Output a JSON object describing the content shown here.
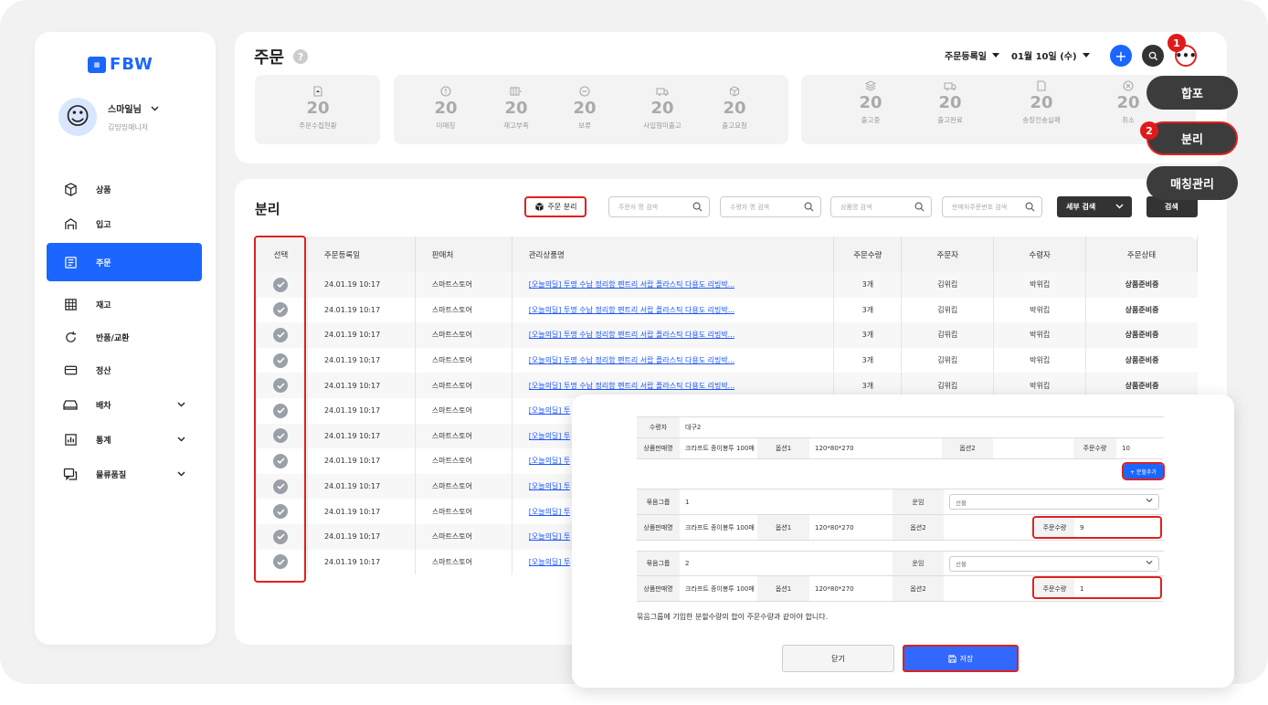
{
  "app": {
    "logo": "FBW"
  },
  "profile": {
    "name": "스마일님",
    "role": "김밍밍매니저"
  },
  "sidebar": {
    "items": [
      {
        "label": "상품",
        "icon": "box-icon"
      },
      {
        "label": "입고",
        "icon": "warehouse-icon"
      },
      {
        "label": "주문",
        "icon": "order-icon",
        "active": true
      },
      {
        "label": "재고",
        "icon": "grid-icon"
      },
      {
        "label": "반품/교환",
        "icon": "refresh-icon"
      },
      {
        "label": "정산",
        "icon": "card-icon"
      },
      {
        "label": "배차",
        "icon": "car-icon",
        "expandable": true
      },
      {
        "label": "통계",
        "icon": "chart-icon",
        "expandable": true
      },
      {
        "label": "물류품질",
        "icon": "chat-icon",
        "expandable": true
      }
    ]
  },
  "header": {
    "title": "주문",
    "date_type": "주문등록일",
    "date": "01월 10일 (수)",
    "stats_group1": [
      {
        "value": "20",
        "label": "주문수집현황"
      }
    ],
    "stats_group2": [
      {
        "value": "20",
        "label": "미매칭"
      },
      {
        "value": "20",
        "label": "재고부족"
      },
      {
        "value": "20",
        "label": "보류"
      },
      {
        "value": "20",
        "label": "사입형미출고"
      },
      {
        "value": "20",
        "label": "출고요청"
      }
    ],
    "stats_group3": [
      {
        "value": "20",
        "label": "출고중"
      },
      {
        "value": "20",
        "label": "출고완료"
      },
      {
        "value": "20",
        "label": "송장전송실패"
      },
      {
        "value": "20",
        "label": "취소"
      }
    ]
  },
  "actions": {
    "merge": "합포",
    "split": "분리",
    "matching": "매칭관리",
    "badge1": "1",
    "badge2": "2"
  },
  "main": {
    "title": "분리",
    "split_button": "주문 분리",
    "search_placeholders": [
      "주문자 명 검색",
      "수령자 명 검색",
      "상품명 검색",
      "판매처주문번호 검색"
    ],
    "detail_search": "세부 검색",
    "search": "검색",
    "columns": [
      "선택",
      "주문등록일",
      "판매처",
      "관리상품명",
      "주문수량",
      "주문자",
      "수령자",
      "주문상태"
    ],
    "rows": [
      {
        "date": "24.01.19 10:17",
        "seller": "스마트스토어",
        "product": "[오늘의딜] 투명 수납 정리함 펜트리 서랍 플라스틱 다용도 리빙박...",
        "qty": "3개",
        "orderer": "김위킵",
        "receiver": "박위킵",
        "status": "상품준비중"
      },
      {
        "date": "24.01.19 10:17",
        "seller": "스마트스토어",
        "product": "[오늘의딜] 투명 수납 정리함 펜트리 서랍 플라스틱 다용도 리빙박...",
        "qty": "3개",
        "orderer": "김위킵",
        "receiver": "박위킵",
        "status": "상품준비중"
      },
      {
        "date": "24.01.19 10:17",
        "seller": "스마트스토어",
        "product": "[오늘의딜] 투명 수납 정리함 펜트리 서랍 플라스틱 다용도 리빙박...",
        "qty": "3개",
        "orderer": "김위킵",
        "receiver": "박위킵",
        "status": "상품준비중"
      },
      {
        "date": "24.01.19 10:17",
        "seller": "스마트스토어",
        "product": "[오늘의딜] 투명 수납 정리함 펜트리 서랍 플라스틱 다용도 리빙박...",
        "qty": "3개",
        "orderer": "김위킵",
        "receiver": "박위킵",
        "status": "상품준비중"
      },
      {
        "date": "24.01.19 10:17",
        "seller": "스마트스토어",
        "product": "[오늘의딜] 투명 수납 정리함 펜트리 서랍 플라스틱 다용도 리빙박...",
        "qty": "3개",
        "orderer": "김위킵",
        "receiver": "박위킵",
        "status": "상품준비중"
      },
      {
        "date": "24.01.19 10:17",
        "seller": "스마트스토어",
        "product": "[오늘의딜] 투"
      },
      {
        "date": "24.01.19 10:17",
        "seller": "스마트스토어",
        "product": "[오늘의딜] 투"
      },
      {
        "date": "24.01.19 10:17",
        "seller": "스마트스토어",
        "product": "[오늘의딜] 투"
      },
      {
        "date": "24.01.19 10:17",
        "seller": "스마트스토어",
        "product": "[오늘의딜] 투"
      },
      {
        "date": "24.01.19 10:17",
        "seller": "스마트스토어",
        "product": "[오늘의딜] 투"
      },
      {
        "date": "24.01.19 10:17",
        "seller": "스마트스토어",
        "product": "[오늘의딜] 투"
      },
      {
        "date": "24.01.19 10:17",
        "seller": "스마트스토어",
        "product": "[오늘의딜] 투"
      }
    ]
  },
  "modal": {
    "receiver_label": "수령자",
    "receiver_value": "대구2",
    "product_label": "상품판매명",
    "product_value": "크라프트 종이봉투 100매",
    "opt1_label": "옵션1",
    "opt1_value": "120*80*270",
    "opt2_label": "옵션2",
    "opt2_value": "",
    "qty_label": "주문수량",
    "qty_value": "10",
    "add_split": "+ 분할추가",
    "groups": [
      {
        "group_label": "묶음그룹",
        "group_value": "1",
        "ship_label": "운임",
        "ship_value": "선불",
        "product_label": "상품판매명",
        "product_value": "크라프트 종이봉투 100매",
        "opt1_label": "옵션1",
        "opt1_value": "120*80*270",
        "opt2_label": "옵션2",
        "qty_label": "주문수량",
        "qty_value": "9"
      },
      {
        "group_label": "묶음그룹",
        "group_value": "2",
        "ship_label": "운임",
        "ship_value": "선불",
        "product_label": "상품판매명",
        "product_value": "크라프트 종이봉투 100매",
        "opt1_label": "옵션1",
        "opt1_value": "120*80*270",
        "opt2_label": "옵션2",
        "qty_label": "주문수량",
        "qty_value": "1"
      }
    ],
    "note": "묶음그룹에 기입한 분할수량의 합이 주문수량과 같아야 합니다.",
    "close": "닫기",
    "save": "저장"
  }
}
